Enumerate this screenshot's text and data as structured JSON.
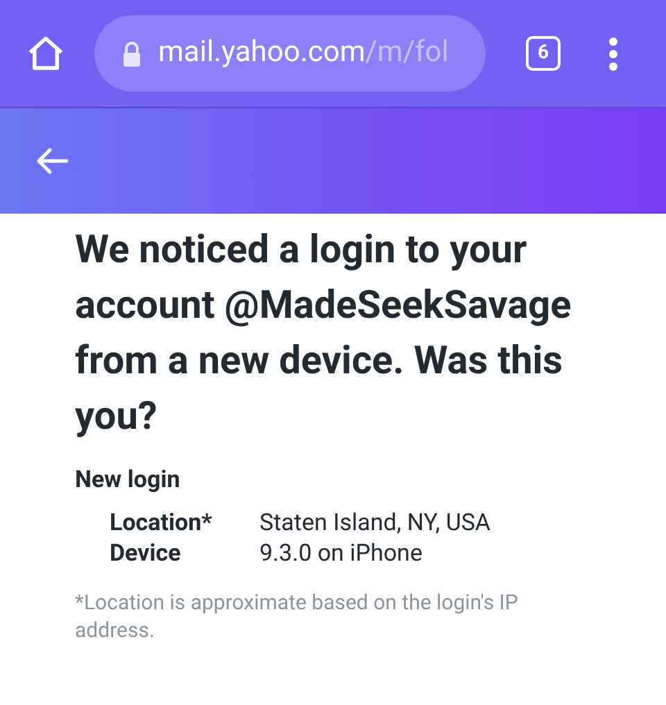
{
  "browser": {
    "url_host": "mail.yahoo.com",
    "url_path": "/m/fol",
    "tab_count": "6"
  },
  "heading": "We noticed a login to your account @MadeSeekSavage from a new device. Was this you?",
  "details": {
    "title": "New login",
    "rows": [
      {
        "label": "Location*",
        "value": "Staten Island, NY, USA"
      },
      {
        "label": "Device",
        "value": "9.3.0 on iPhone"
      }
    ]
  },
  "note": "*Location is approximate based on the login's IP address."
}
